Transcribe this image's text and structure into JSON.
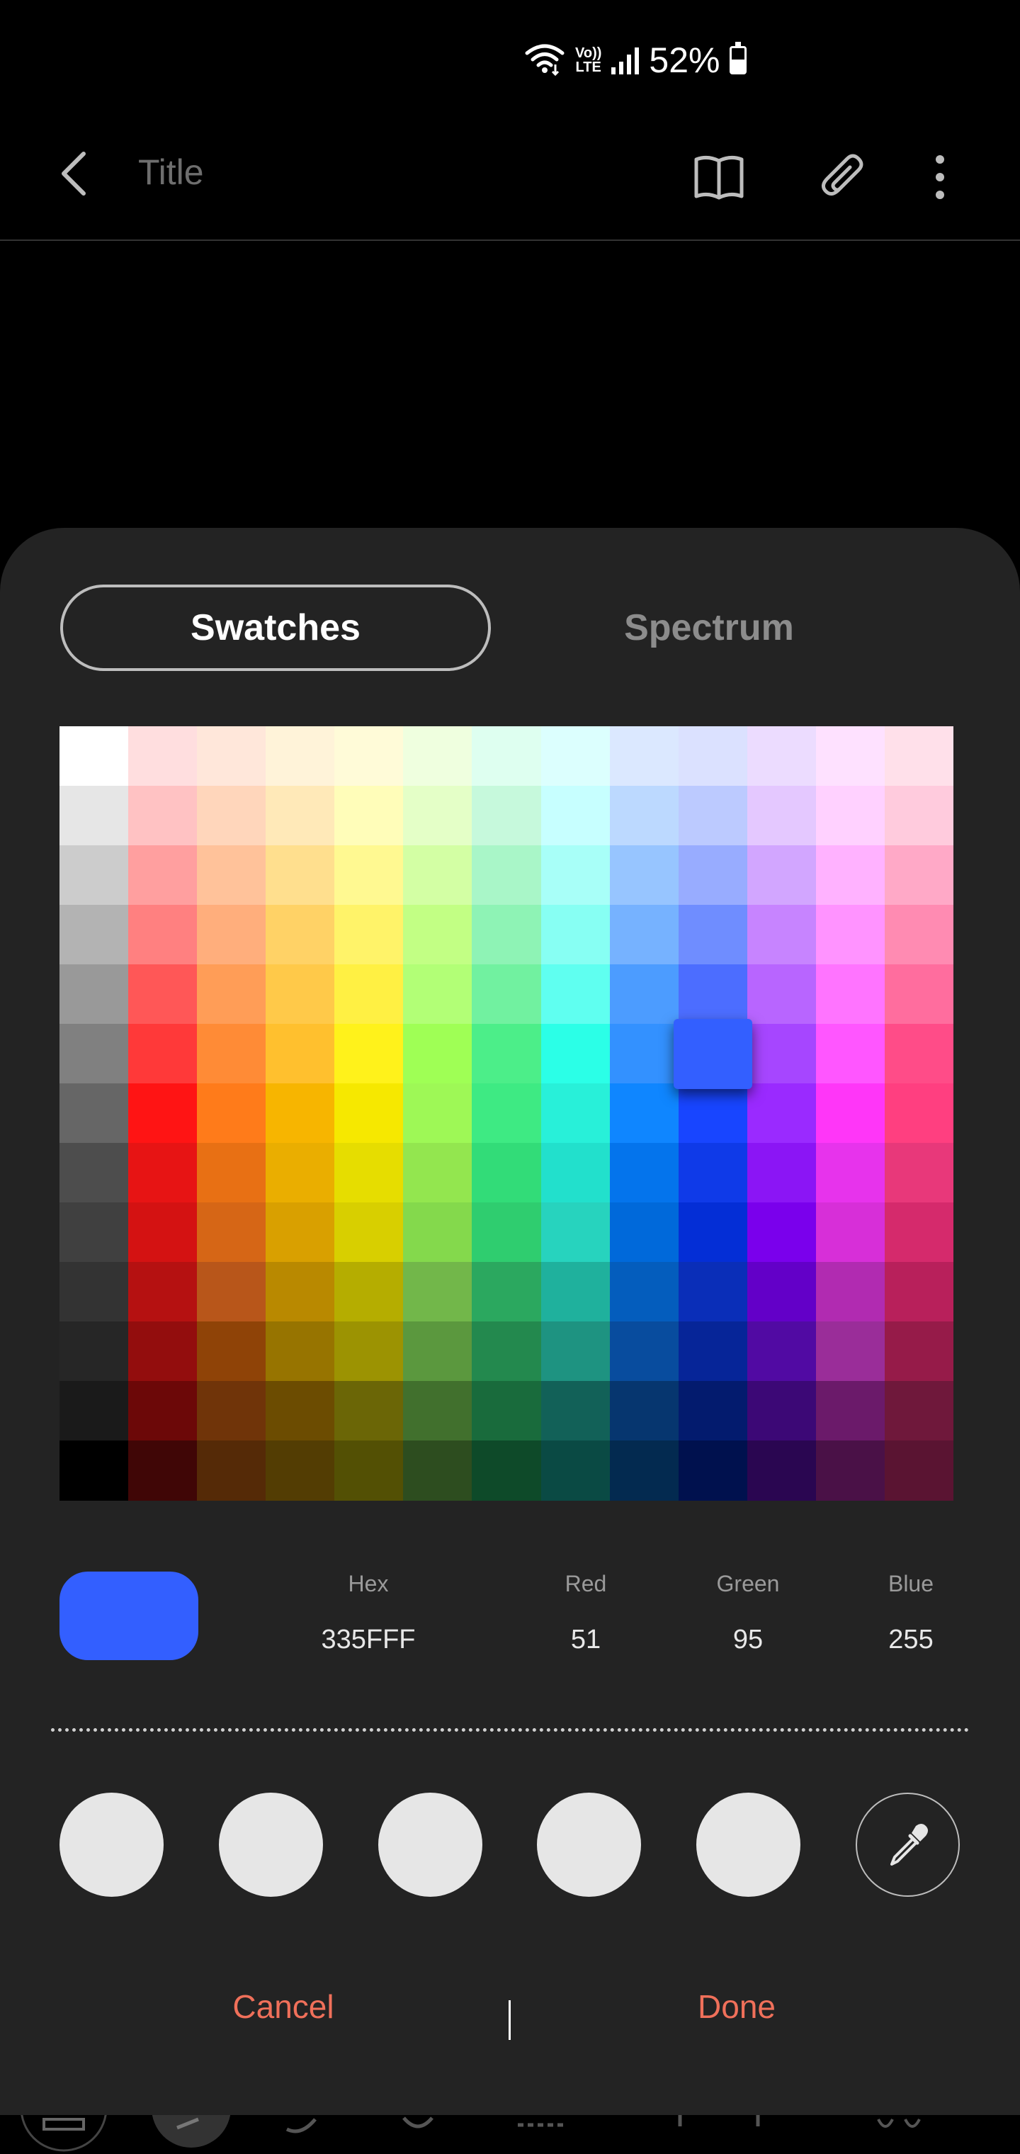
{
  "status_bar": {
    "battery": "52%",
    "network_top": "Vo))",
    "network_bottom": "LTE"
  },
  "app_bar": {
    "title_placeholder": "Title",
    "icons": [
      "back-icon",
      "book-icon",
      "paperclip-icon",
      "more-icon"
    ]
  },
  "color_picker": {
    "tabs": [
      {
        "label": "Swatches",
        "active": true
      },
      {
        "label": "Spectrum",
        "active": false
      }
    ],
    "selected_swatch": {
      "row": 5,
      "col": 9
    },
    "swatches": [
      [
        "#ffffff",
        "#ffdedf",
        "#ffe7da",
        "#fff3d9",
        "#fffbd8",
        "#efffdf",
        "#defff0",
        "#dcfffe",
        "#dbe8ff",
        "#dbe1ff",
        "#ecdcff",
        "#fee1ff",
        "#ffe0ea"
      ],
      [
        "#e6e6e6",
        "#ffc2c3",
        "#ffd6bb",
        "#ffe9b8",
        "#fffdb9",
        "#e4ffc7",
        "#c6f9dc",
        "#c7ffff",
        "#bcd9ff",
        "#bccaff",
        "#e4c8ff",
        "#ffd1ff",
        "#ffcbdd"
      ],
      [
        "#cccccc",
        "#ff9f9f",
        "#ffc29a",
        "#ffdf8e",
        "#fff991",
        "#d3ffa4",
        "#a9f6c8",
        "#a8fff8",
        "#97c5ff",
        "#98acff",
        "#d2a6ff",
        "#ffb2ff",
        "#ffa9c7"
      ],
      [
        "#b3b3b3",
        "#ff8080",
        "#ffae7c",
        "#ffd266",
        "#fff369",
        "#c2ff84",
        "#8ef3b5",
        "#87fff3",
        "#76b2ff",
        "#6f8dff",
        "#c784ff",
        "#ff93ff",
        "#ff8bb2"
      ],
      [
        "#999999",
        "#ff5757",
        "#ff9d57",
        "#ffc949",
        "#fff043",
        "#b2ff76",
        "#71f1a0",
        "#5ffff0",
        "#4c9cff",
        "#4c6dff",
        "#b865ff",
        "#ff74ff",
        "#ff6d9e"
      ],
      [
        "#808080",
        "#ff3939",
        "#ff8b36",
        "#ffc02e",
        "#fff21b",
        "#9fff55",
        "#4cee89",
        "#2bffe7",
        "#3391ff",
        "#335fff",
        "#a646ff",
        "#ff56ff",
        "#ff4c88"
      ],
      [
        "#666666",
        "#ff1414",
        "#ff7b1a",
        "#f7b500",
        "#f6e800",
        "#9ef856",
        "#3eea83",
        "#28f0d9",
        "#0f86ff",
        "#1845ff",
        "#9a2aff",
        "#ff36f8",
        "#ff3f80"
      ],
      [
        "#4d4d4d",
        "#e71414",
        "#e87014",
        "#eaae00",
        "#e6dd00",
        "#93e64f",
        "#32dc78",
        "#22e0cc",
        "#0474ec",
        "#0f3ae8",
        "#8b15f5",
        "#e733ec",
        "#e8387a"
      ],
      [
        "#404040",
        "#d41212",
        "#d66616",
        "#d9a000",
        "#d8cf00",
        "#84d94c",
        "#2fcd6f",
        "#27d3be",
        "#0069da",
        "#042ed6",
        "#7a00ec",
        "#d72fd8",
        "#d52a6c"
      ],
      [
        "#333333",
        "#b51111",
        "#b8561a",
        "#b98900",
        "#b5ad00",
        "#72b74a",
        "#2ba85f",
        "#1fb19d",
        "#045dbd",
        "#0a2eb8",
        "#6300c8",
        "#b12bb1",
        "#b8205b"
      ],
      [
        "#262626",
        "#930d0d",
        "#8f4307",
        "#977400",
        "#9c9302",
        "#5b983e",
        "#23894e",
        "#1e9381",
        "#084c9e",
        "#062598",
        "#510aa3",
        "#9a2d99",
        "#961b49"
      ],
      [
        "#1a1a1a",
        "#6c0808",
        "#703409",
        "#6c4c01",
        "#6b6606",
        "#41702d",
        "#196b3c",
        "#126158",
        "#06366f",
        "#031b6e",
        "#3c0876",
        "#6b1a6a",
        "#6f183b"
      ],
      [
        "#000000",
        "#400606",
        "#552a07",
        "#533d03",
        "#535004",
        "#2d4d1f",
        "#0e4a29",
        "#0a4a44",
        "#032a50",
        "#00114e",
        "#2a0651",
        "#4a1147",
        "#5a1432"
      ]
    ],
    "current_color": "#335fff",
    "fields": [
      {
        "label": "Hex",
        "value": "335FFF"
      },
      {
        "label": "Red",
        "value": "51"
      },
      {
        "label": "Green",
        "value": "95"
      },
      {
        "label": "Blue",
        "value": "255"
      }
    ],
    "recent_colors": [
      "#e6e6e6",
      "#e6e6e6",
      "#e6e6e6",
      "#e6e6e6",
      "#e6e6e6"
    ],
    "cancel_label": "Cancel",
    "done_label": "Done",
    "accent": "#f0705a"
  }
}
